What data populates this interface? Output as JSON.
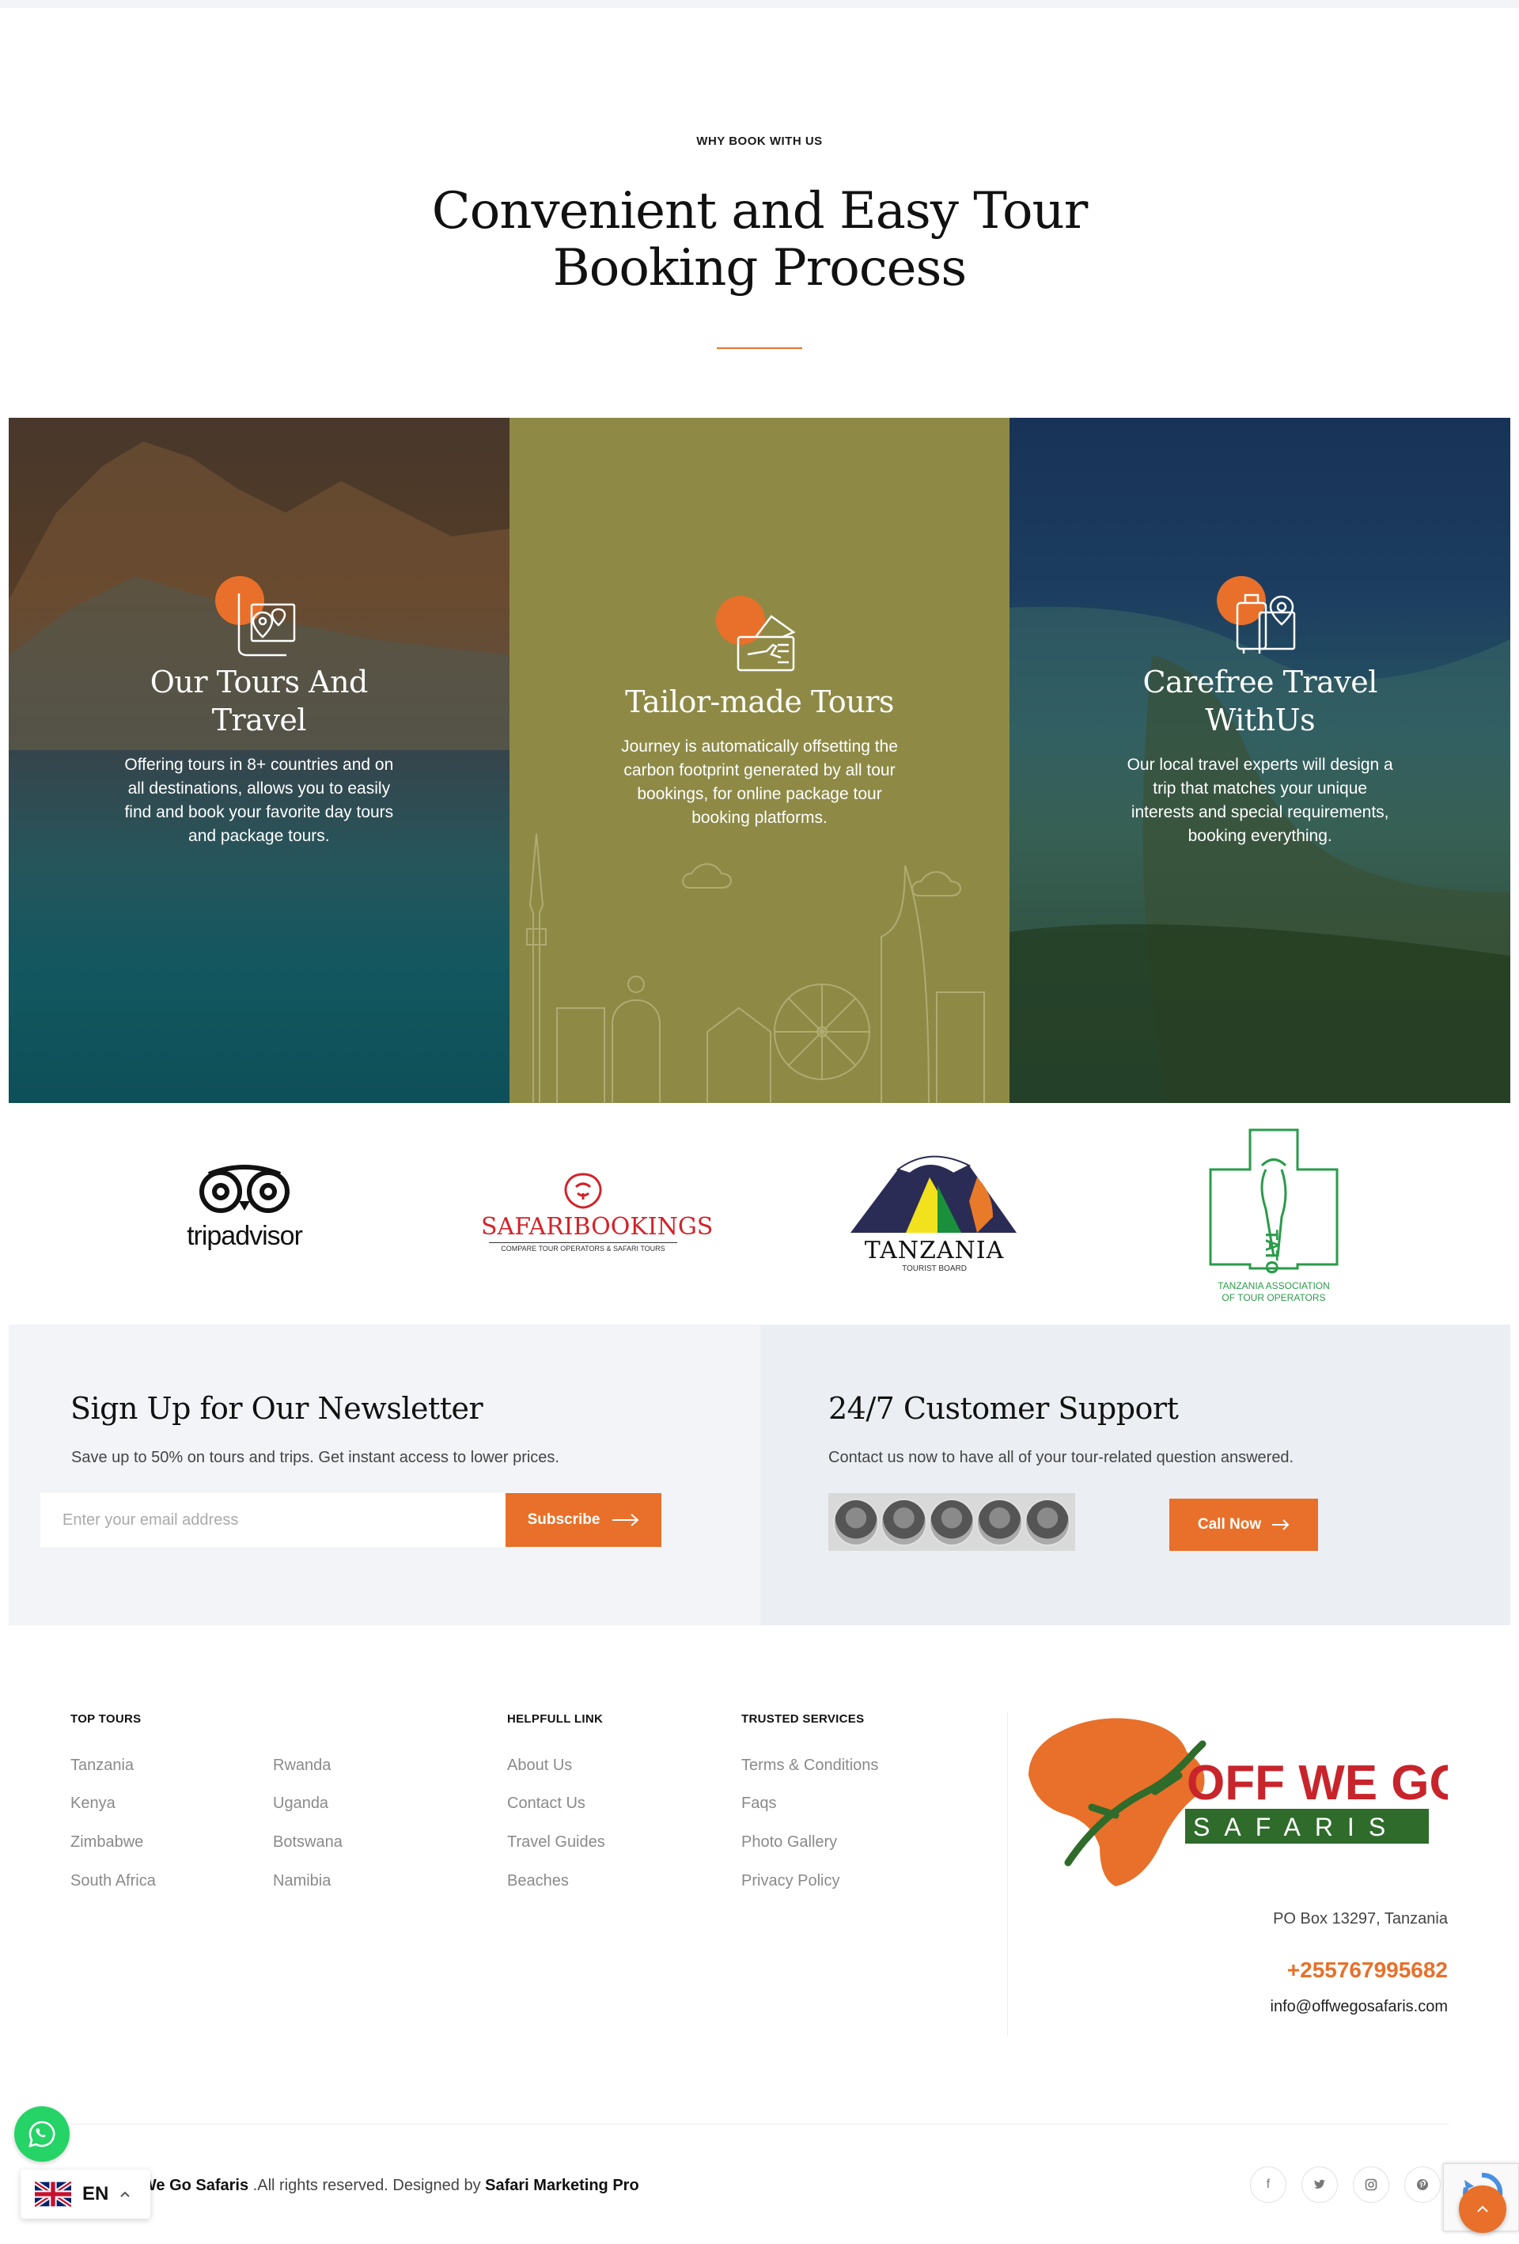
{
  "why": {
    "kicker": "WHY BOOK WITH US",
    "title_line1": "Convenient and Easy Tour",
    "title_line2": "Booking Process"
  },
  "features": [
    {
      "title_line1": "Our Tours And",
      "title_line2": "Travel",
      "text": "Offering tours in 8+ countries and on all destinations, allows you to easily find and book your favorite day tours and package tours.",
      "icon": "map-pin-icon"
    },
    {
      "title_line1": "Tailor-made Tours",
      "title_line2": "",
      "text": "Journey is automatically offsetting the carbon footprint generated by all tour bookings, for online package tour booking platforms.",
      "icon": "ticket-icon"
    },
    {
      "title_line1": "Carefree Travel",
      "title_line2": "WithUs",
      "text": "Our local travel experts will design a trip that matches your unique interests and special requirements, booking everything.",
      "icon": "luggage-icon"
    }
  ],
  "partners": {
    "tripadvisor": "tripadvisor",
    "safaribookings": "SAFARIBOOKINGS",
    "safaribookings_sub": "COMPARE TOUR OPERATORS & SAFARI TOURS",
    "tanzania": "TANZANIA",
    "tanzania_sub": "TOURIST BOARD",
    "tato_line1": "TANZANIA ASSOCIATION",
    "tato_line2": "OF TOUR OPERATORS",
    "tato_mark": "TATO"
  },
  "newsletter": {
    "title": "Sign Up for Our Newsletter",
    "description": "Save up to 50% on tours and trips. Get instant access to lower prices.",
    "placeholder": "Enter your email address",
    "button": "Subscribe"
  },
  "support": {
    "title": "24/7 Customer Support",
    "description": "Contact us now to have all of your tour-related question answered.",
    "button": "Call Now"
  },
  "footer": {
    "top_tours_title": "TOP TOURS",
    "top_tours_col1": [
      "Tanzania",
      "Kenya",
      "Zimbabwe",
      "South Africa"
    ],
    "top_tours_col2": [
      "Rwanda",
      "Uganda",
      "Botswana",
      "Namibia"
    ],
    "helpful_title": "HELPFULL LINK",
    "helpful_links": [
      "About Us",
      "Contact Us",
      "Travel Guides",
      "Beaches"
    ],
    "trusted_title": "TRUSTED SERVICES",
    "trusted_links": [
      "Terms & Conditions",
      "Faqs",
      "Photo Gallery",
      "Privacy Policy"
    ],
    "logo_text1": "OFF WE GO",
    "logo_text2": "SAFARIS",
    "address": "PO Box 13297, Tanzania",
    "phone": "+255767995682",
    "email": "info@offwegosafaris.com",
    "copyright_brand": "ff We Go Safaris",
    "copyright_mid": " .All rights reserved. Designed by ",
    "copyright_designer": "Safari Marketing Pro"
  },
  "social_icons": [
    "facebook-icon",
    "twitter-icon",
    "instagram-icon",
    "pinterest-icon"
  ],
  "language": {
    "code": "EN"
  },
  "colors": {
    "accent": "#e8702a",
    "olive": "#8e8a46",
    "green": "#25d366"
  }
}
